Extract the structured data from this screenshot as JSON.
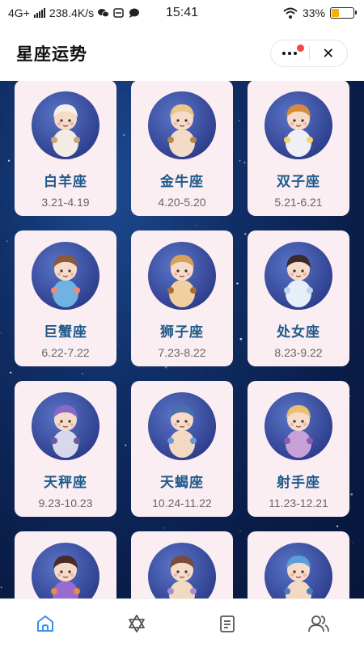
{
  "status_bar": {
    "network": "4G+",
    "speed": "238.4K/s",
    "time": "15:41",
    "battery": "33%",
    "battery_level": 0.33
  },
  "header": {
    "title": "星座运势"
  },
  "zodiac": [
    {
      "name": "白羊座",
      "dates": "3.21-4.19",
      "icon": "aries-icon"
    },
    {
      "name": "金牛座",
      "dates": "4.20-5.20",
      "icon": "taurus-icon"
    },
    {
      "name": "双子座",
      "dates": "5.21-6.21",
      "icon": "gemini-icon"
    },
    {
      "name": "巨蟹座",
      "dates": "6.22-7.22",
      "icon": "cancer-icon"
    },
    {
      "name": "狮子座",
      "dates": "7.23-8.22",
      "icon": "leo-icon"
    },
    {
      "name": "处女座",
      "dates": "8.23-9.22",
      "icon": "virgo-icon"
    },
    {
      "name": "天秤座",
      "dates": "9.23-10.23",
      "icon": "libra-icon"
    },
    {
      "name": "天蝎座",
      "dates": "10.24-11.22",
      "icon": "scorpio-icon"
    },
    {
      "name": "射手座",
      "dates": "11.23-12.21",
      "icon": "sagittarius-icon"
    },
    {
      "name": "",
      "dates": "",
      "icon": "capricorn-icon"
    },
    {
      "name": "",
      "dates": "",
      "icon": "aquarius-icon"
    },
    {
      "name": "",
      "dates": "",
      "icon": "pisces-icon"
    }
  ],
  "tabbar": {
    "tabs": [
      {
        "icon": "home-icon",
        "active": true
      },
      {
        "icon": "star-of-david-icon",
        "active": false
      },
      {
        "icon": "notes-icon",
        "active": false
      },
      {
        "icon": "users-icon",
        "active": false
      }
    ]
  },
  "colors": {
    "accent": "#3a8ee6",
    "card_bg": "#fbeef2",
    "name_text": "#1e5a8a",
    "icon_gray": "#555555"
  }
}
